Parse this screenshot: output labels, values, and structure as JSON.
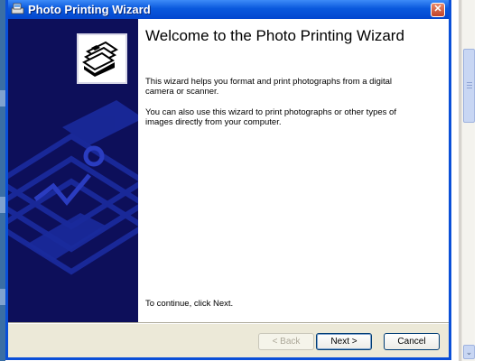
{
  "window": {
    "title": "Photo Printing Wizard",
    "close_glyph": "✕"
  },
  "content": {
    "heading": "Welcome to the Photo Printing Wizard",
    "paragraph_1": "This wizard helps you format and print photographs from a digital camera or scanner.",
    "paragraph_2": "You can also use this wizard to print photographs or other types of images directly from your computer.",
    "continue_text": "To continue, click Next."
  },
  "buttons": {
    "back_label": "< Back",
    "next_label": "Next >",
    "cancel_label": "Cancel"
  },
  "icons": {
    "title_icon": "photo-printer-icon",
    "wizard_icon": "photo-stack-printer-icon",
    "close": "close-icon"
  },
  "colors": {
    "titlebar": "#0a59dd",
    "side_panel": "#0d0f5a",
    "dialog_bg": "#ece9d8"
  }
}
